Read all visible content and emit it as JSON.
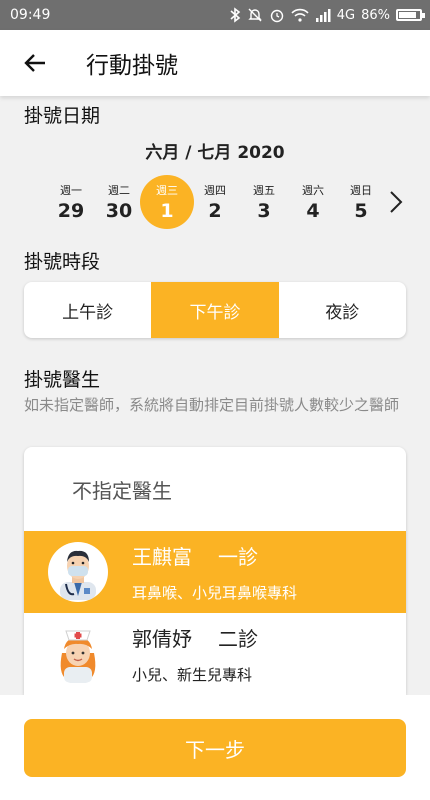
{
  "status_bar": {
    "time": "09:49",
    "network": "4G",
    "battery": "86%",
    "battery_level": 0.86
  },
  "header": {
    "title": "行動掛號"
  },
  "date_section": {
    "label": "掛號日期",
    "month": "六月 / 七月 2020",
    "days": [
      {
        "weekday": "週一",
        "date": "29",
        "selected": false
      },
      {
        "weekday": "週二",
        "date": "30",
        "selected": false
      },
      {
        "weekday": "週三",
        "date": "1",
        "selected": true
      },
      {
        "weekday": "週四",
        "date": "2",
        "selected": false
      },
      {
        "weekday": "週五",
        "date": "3",
        "selected": false
      },
      {
        "weekday": "週六",
        "date": "4",
        "selected": false
      },
      {
        "weekday": "週日",
        "date": "5",
        "selected": false
      }
    ]
  },
  "session_section": {
    "label": "掛號時段",
    "options": [
      "上午診",
      "下午診",
      "夜診"
    ],
    "selected_index": 1
  },
  "doctor_section": {
    "label": "掛號醫生",
    "note": "如未指定醫師，系統將自動排定目前掛號人數較少之醫師",
    "no_preference": "不指定醫生",
    "doctors": [
      {
        "name": "王麒富",
        "clinic": "一診",
        "specialty": "耳鼻喉、小兒耳鼻喉專科",
        "selected": true
      },
      {
        "name": "郭倩妤",
        "clinic": "二診",
        "specialty": "小兒、新生兒專科",
        "selected": false
      }
    ]
  },
  "footer": {
    "next_label": "下一步"
  },
  "colors": {
    "accent": "#fbb324",
    "status_bar": "#6f6f6f"
  }
}
